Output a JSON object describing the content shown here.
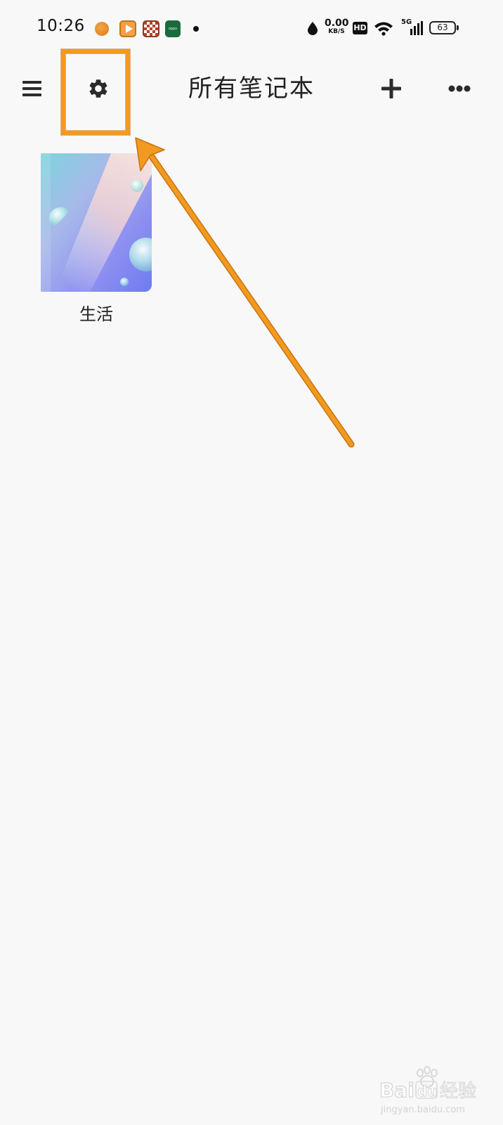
{
  "status_bar": {
    "time": "10:26",
    "net_speed_value": "0.00",
    "net_speed_unit": "KB/S",
    "hd_label": "HD",
    "signal_label": "5G",
    "battery_level": "63",
    "notification_icons": [
      "basketball-app-icon",
      "video-app-icon",
      "checkered-app-icon",
      "oppo-app-icon"
    ],
    "notification_oppo_label": "oppo"
  },
  "toolbar": {
    "title": "所有笔记本",
    "menu_icon": "hamburger-menu-icon",
    "settings_icon": "gear-icon",
    "add_icon": "plus-icon",
    "more_icon": "more-dots-icon"
  },
  "notebooks": [
    {
      "name": "生活",
      "cover": "blue-pink-bubble-gradient"
    }
  ],
  "annotation": {
    "color": "#f29a1f",
    "target": "settings-button"
  },
  "watermark": {
    "brand": "Baidu经验",
    "url": "jingyan.baidu.com"
  }
}
